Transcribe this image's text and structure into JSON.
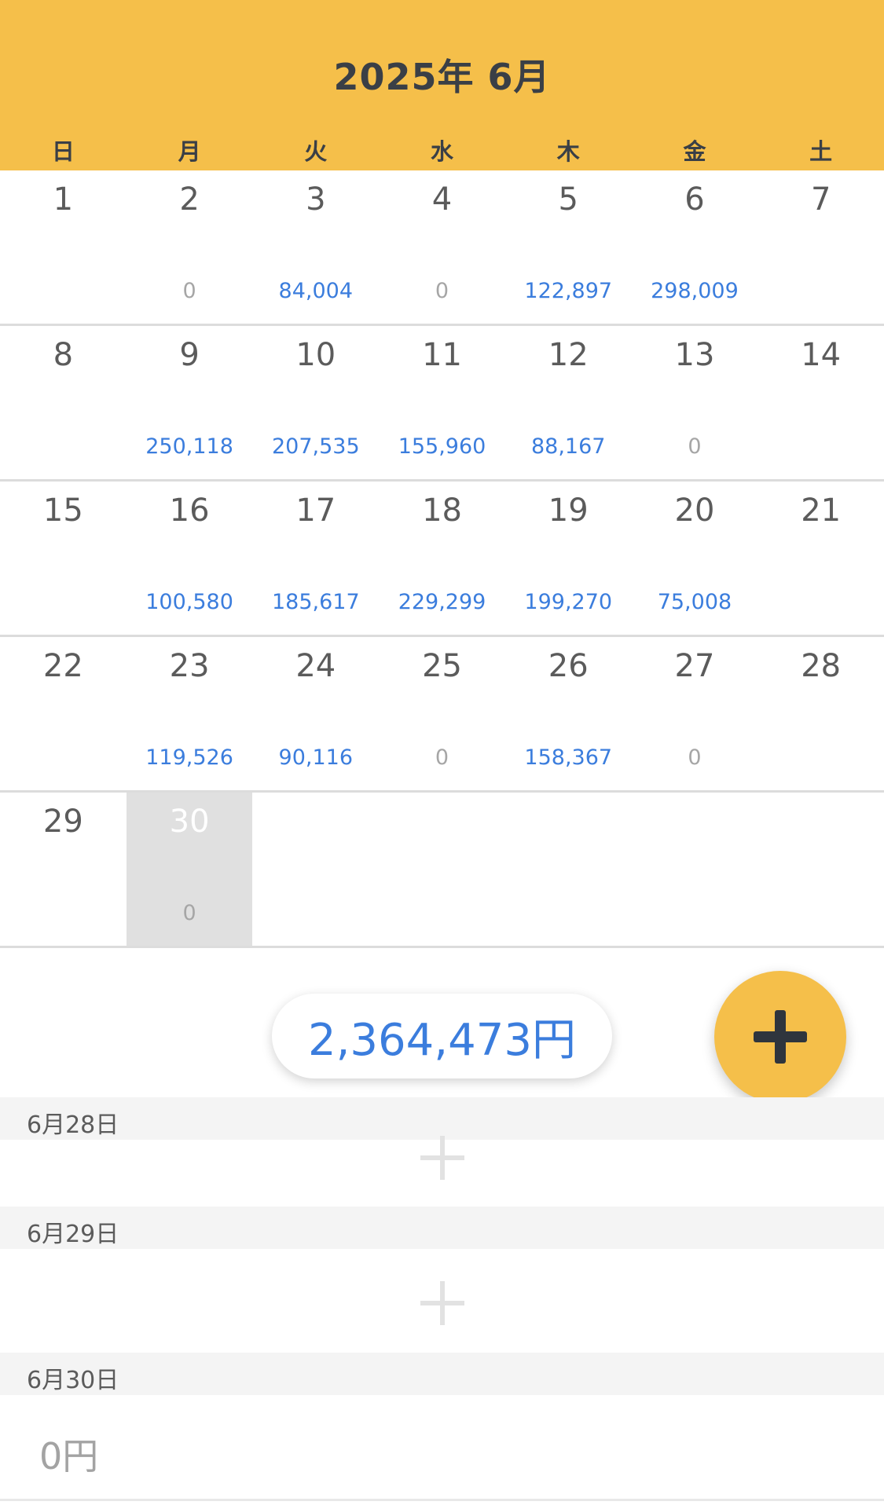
{
  "header": {
    "title": "2025年 6月",
    "accent_color": "#F5BF4A",
    "weekdays": [
      "日",
      "月",
      "火",
      "水",
      "木",
      "金",
      "土"
    ]
  },
  "calendar": {
    "weeks": [
      [
        {
          "day": "1",
          "amount": ""
        },
        {
          "day": "2",
          "amount": "0"
        },
        {
          "day": "3",
          "amount": "84,004"
        },
        {
          "day": "4",
          "amount": "0"
        },
        {
          "day": "5",
          "amount": "122,897"
        },
        {
          "day": "6",
          "amount": "298,009"
        },
        {
          "day": "7",
          "amount": ""
        }
      ],
      [
        {
          "day": "8",
          "amount": ""
        },
        {
          "day": "9",
          "amount": "250,118"
        },
        {
          "day": "10",
          "amount": "207,535"
        },
        {
          "day": "11",
          "amount": "155,960"
        },
        {
          "day": "12",
          "amount": "88,167"
        },
        {
          "day": "13",
          "amount": "0"
        },
        {
          "day": "14",
          "amount": ""
        }
      ],
      [
        {
          "day": "15",
          "amount": ""
        },
        {
          "day": "16",
          "amount": "100,580"
        },
        {
          "day": "17",
          "amount": "185,617"
        },
        {
          "day": "18",
          "amount": "229,299"
        },
        {
          "day": "19",
          "amount": "199,270"
        },
        {
          "day": "20",
          "amount": "75,008"
        },
        {
          "day": "21",
          "amount": ""
        }
      ],
      [
        {
          "day": "22",
          "amount": ""
        },
        {
          "day": "23",
          "amount": "119,526"
        },
        {
          "day": "24",
          "amount": "90,116"
        },
        {
          "day": "25",
          "amount": "0"
        },
        {
          "day": "26",
          "amount": "158,367"
        },
        {
          "day": "27",
          "amount": "0"
        },
        {
          "day": "28",
          "amount": ""
        }
      ],
      [
        {
          "day": "29",
          "amount": ""
        },
        {
          "day": "30",
          "amount": "0",
          "selected": true
        },
        {
          "day": "",
          "amount": ""
        },
        {
          "day": "",
          "amount": ""
        },
        {
          "day": "",
          "amount": ""
        },
        {
          "day": "",
          "amount": ""
        },
        {
          "day": "",
          "amount": ""
        }
      ]
    ]
  },
  "summary": {
    "total": "2,364,473円"
  },
  "fab": {
    "icon": "plus-icon"
  },
  "day_list": [
    {
      "label": "6月28日"
    },
    {
      "label": "6月29日"
    },
    {
      "label": "6月30日",
      "amount": "0円"
    }
  ]
}
